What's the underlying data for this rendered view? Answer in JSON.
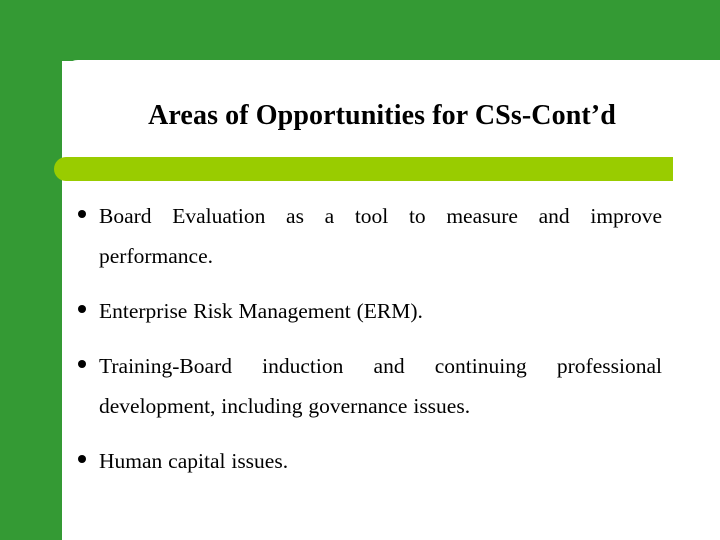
{
  "slide": {
    "title": "Areas of Opportunities for CSs-Cont’d",
    "bullets": [
      {
        "text": "Board Evaluation as a tool to measure and improve performance.",
        "justified": true
      },
      {
        "text": "Enterprise Risk Management (ERM).",
        "justified": false
      },
      {
        "text": "Training-Board induction and continuing professional development, including governance issues.",
        "justified": true
      },
      {
        "text": "Human capital issues.",
        "justified": false
      }
    ]
  },
  "theme": {
    "sidebar_color": "#349A34",
    "accent_bar_color": "#99CC00",
    "panel_color": "#ffffff",
    "text_color": "#000000"
  }
}
